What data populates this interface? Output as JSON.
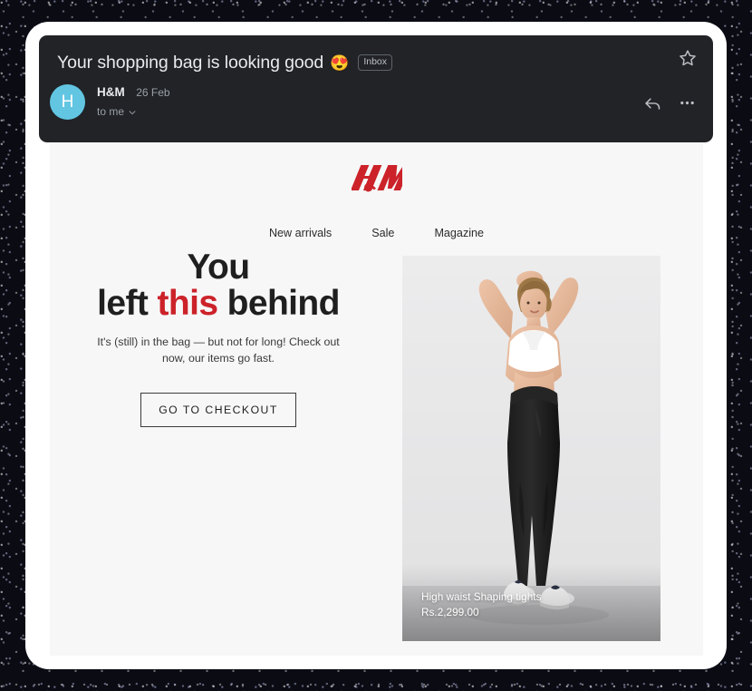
{
  "mail": {
    "subject": "Your shopping bag is looking good",
    "subject_emoji": "😍",
    "label": "Inbox",
    "star_icon": "star-outline-icon",
    "sender_initial": "H",
    "sender_name": "H&M",
    "date": "26 Feb",
    "recipient": "to me",
    "recipient_chevron": "chevron-down-icon",
    "reply_icon": "reply-arrow-icon",
    "more_icon": "more-options-icon"
  },
  "email": {
    "brand": "H&M",
    "nav": [
      {
        "label": "New arrivals"
      },
      {
        "label": "Sale"
      },
      {
        "label": "Magazine"
      }
    ],
    "headline_line1": "You",
    "headline_line2_a": "left ",
    "headline_line2_b": "this",
    "headline_line2_c": " behind",
    "subcopy": "It's (still) in the bag — but not for long! Check out now, our items go fast.",
    "cta_label": "GO TO CHECKOUT",
    "product": {
      "name": "High waist Shaping tights",
      "price": "Rs.2,299.00"
    }
  },
  "colors": {
    "header_bg": "#212327",
    "body_bg": "#f7f7f7",
    "brand_red": "#cc2229",
    "accent_red": "#cc2229",
    "avatar_bg": "#62c6e2",
    "text_dark": "#1f1f1f",
    "text_muted": "#9aa0a6"
  }
}
